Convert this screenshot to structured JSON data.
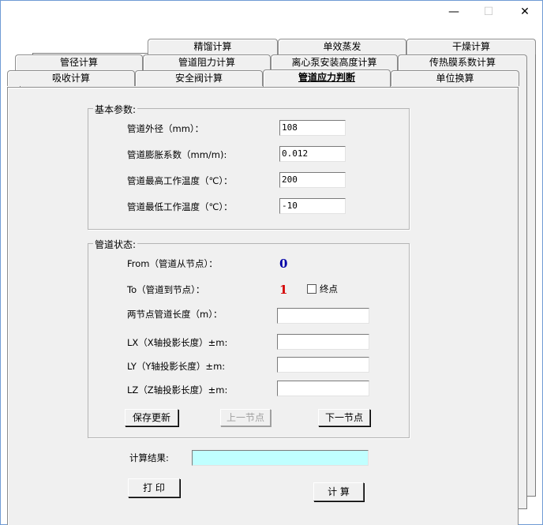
{
  "window": {
    "minimize_icon": "minimize-icon",
    "maximize_icon": "maximize-icon",
    "close_icon": "close-icon"
  },
  "tabs": {
    "row1": [
      "精馏计算",
      "单效蒸发",
      "干燥计算"
    ],
    "row2": [
      "管径计算",
      "管道阻力计算",
      "离心泵安装高度计算",
      "传热膜系数计算"
    ],
    "row3": [
      "吸收计算",
      "安全阀计算",
      "管道应力判断",
      "单位换算"
    ],
    "active": "管道应力判断"
  },
  "basic": {
    "title": "基本参数:",
    "outer_diameter_label": "管道外径（mm）：",
    "outer_diameter_value": "108",
    "expansion_label": "管道膨胀系数（mm/m):",
    "expansion_value": "0.012",
    "max_temp_label": "管道最高工作温度（℃）：",
    "max_temp_value": "200",
    "min_temp_label": "管道最低工作温度（℃）：",
    "min_temp_value": "-10"
  },
  "state": {
    "title": "管道状态:",
    "from_label": "From（管道从节点）：",
    "from_value": "0",
    "to_label": "To（管道到节点）：",
    "to_value": "1",
    "endpoint_label": "终点",
    "length_label": "两节点管道长度（m）：",
    "lx_label": "LX（X轴投影长度）±m:",
    "ly_label": "LY（Y轴投影长度）±m:",
    "lz_label": "LZ（Z轴投影长度）±m:",
    "save_button": "保存更新",
    "prev_button": "上一节点",
    "next_button": "下一节点"
  },
  "result": {
    "label": "计算结果:",
    "value": ""
  },
  "actions": {
    "print_button": "打  印",
    "calc_button": "计  算"
  },
  "colors": {
    "from_value_color": "#0000a8",
    "to_value_color": "#d40000",
    "result_bg": "#c0ffff"
  }
}
